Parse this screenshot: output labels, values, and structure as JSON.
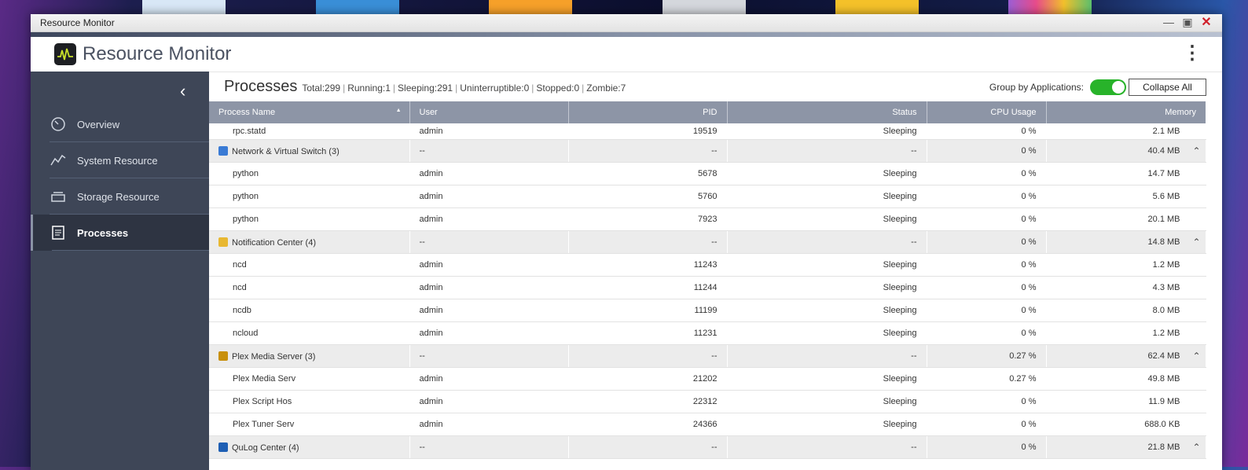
{
  "window": {
    "title": "Resource Monitor"
  },
  "app": {
    "name": "Resource Monitor"
  },
  "sidebar": {
    "items": [
      {
        "label": "Overview",
        "icon": "gauge-icon"
      },
      {
        "label": "System Resource",
        "icon": "line-chart-icon"
      },
      {
        "label": "Storage Resource",
        "icon": "storage-icon"
      },
      {
        "label": "Processes",
        "icon": "document-list-icon",
        "active": true
      }
    ]
  },
  "processes": {
    "title": "Processes",
    "stats": [
      "Total:299",
      "Running:1",
      "Sleeping:291",
      "Uninterruptible:0",
      "Stopped:0",
      "Zombie:7"
    ],
    "group_label": "Group by Applications:",
    "group_enabled": true,
    "collapse_label": "Collapse All"
  },
  "table": {
    "columns": [
      "Process Name",
      "User",
      "PID",
      "Status",
      "CPU Usage",
      "Memory"
    ],
    "sort_glyph": "▲",
    "rows": [
      {
        "type": "proc",
        "name": "rpc.statd",
        "user": "admin",
        "pid": "19519",
        "status": "Sleeping",
        "cpu": "0 %",
        "mem": "2.1 MB"
      },
      {
        "type": "group",
        "name": "Network & Virtual Switch (3)",
        "color": "#3a7bd5",
        "user": "--",
        "pid": "--",
        "status": "--",
        "cpu": "0 %",
        "mem": "40.4 MB"
      },
      {
        "type": "proc",
        "name": "python",
        "user": "admin",
        "pid": "5678",
        "status": "Sleeping",
        "cpu": "0 %",
        "mem": "14.7 MB"
      },
      {
        "type": "proc",
        "name": "python",
        "user": "admin",
        "pid": "5760",
        "status": "Sleeping",
        "cpu": "0 %",
        "mem": "5.6 MB"
      },
      {
        "type": "proc",
        "name": "python",
        "user": "admin",
        "pid": "7923",
        "status": "Sleeping",
        "cpu": "0 %",
        "mem": "20.1 MB"
      },
      {
        "type": "group",
        "name": "Notification Center (4)",
        "color": "#e8b832",
        "user": "--",
        "pid": "--",
        "status": "--",
        "cpu": "0 %",
        "mem": "14.8 MB"
      },
      {
        "type": "proc",
        "name": "ncd",
        "user": "admin",
        "pid": "11243",
        "status": "Sleeping",
        "cpu": "0 %",
        "mem": "1.2 MB"
      },
      {
        "type": "proc",
        "name": "ncd",
        "user": "admin",
        "pid": "11244",
        "status": "Sleeping",
        "cpu": "0 %",
        "mem": "4.3 MB"
      },
      {
        "type": "proc",
        "name": "ncdb",
        "user": "admin",
        "pid": "11199",
        "status": "Sleeping",
        "cpu": "0 %",
        "mem": "8.0 MB"
      },
      {
        "type": "proc",
        "name": "ncloud",
        "user": "admin",
        "pid": "11231",
        "status": "Sleeping",
        "cpu": "0 %",
        "mem": "1.2 MB"
      },
      {
        "type": "group",
        "name": "Plex Media Server (3)",
        "color": "#c8900c",
        "user": "--",
        "pid": "--",
        "status": "--",
        "cpu": "0.27 %",
        "mem": "62.4 MB"
      },
      {
        "type": "proc",
        "name": "Plex Media Serv",
        "user": "admin",
        "pid": "21202",
        "status": "Sleeping",
        "cpu": "0.27 %",
        "mem": "49.8 MB"
      },
      {
        "type": "proc",
        "name": "Plex Script Hos",
        "user": "admin",
        "pid": "22312",
        "status": "Sleeping",
        "cpu": "0 %",
        "mem": "11.9 MB"
      },
      {
        "type": "proc",
        "name": "Plex Tuner Serv",
        "user": "admin",
        "pid": "24366",
        "status": "Sleeping",
        "cpu": "0 %",
        "mem": "688.0 KB"
      },
      {
        "type": "group",
        "name": "QuLog Center (4)",
        "color": "#1e5fb4",
        "user": "--",
        "pid": "--",
        "status": "--",
        "cpu": "0 %",
        "mem": "21.8 MB"
      }
    ]
  },
  "colors": {
    "sidebar": "#3e4657",
    "header": "#8d95a6",
    "toggle_on": "#28b32a",
    "close": "#d0202a"
  }
}
